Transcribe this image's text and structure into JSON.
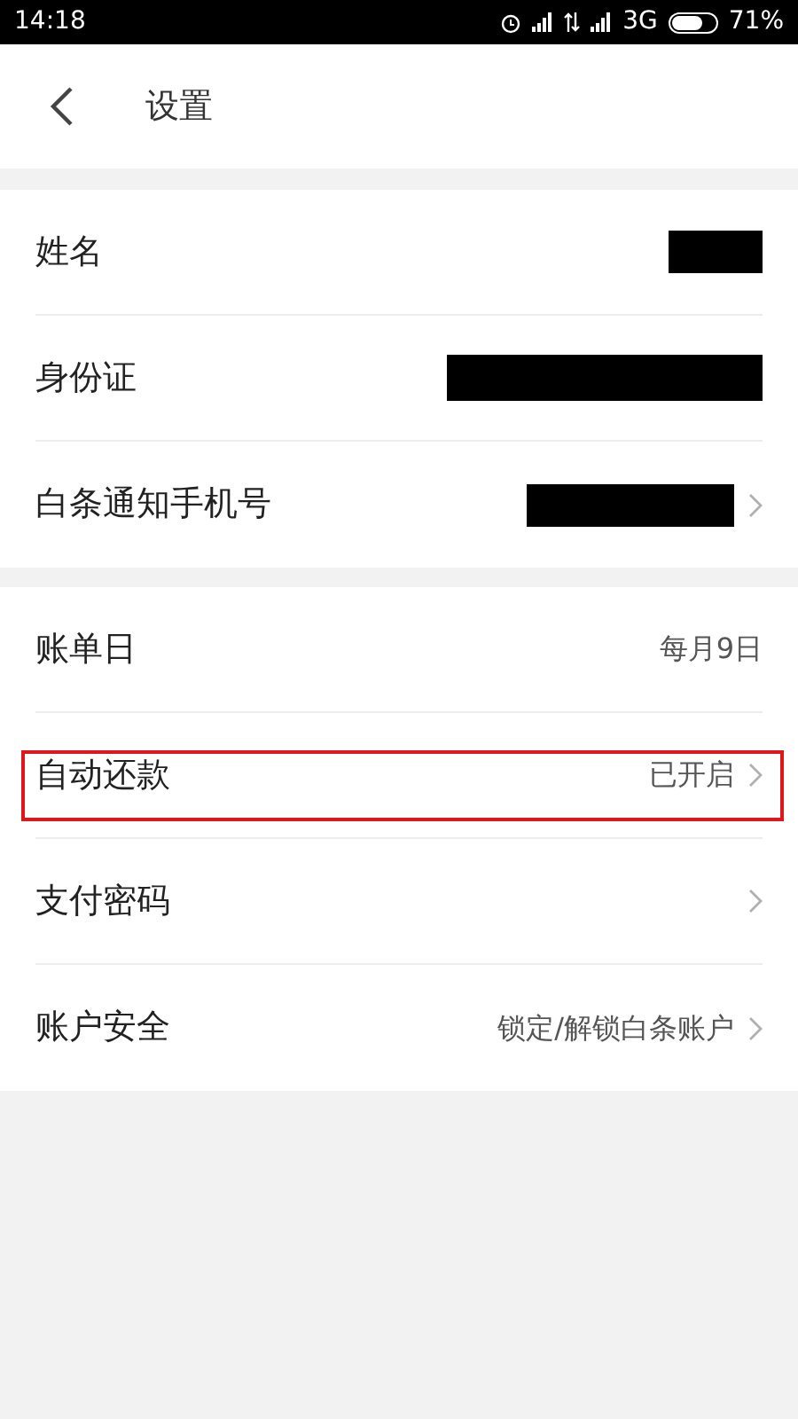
{
  "status_bar": {
    "time": "14:18",
    "network": "3G",
    "battery_text": "71%",
    "battery": {
      "level": 0.71
    }
  },
  "header": {
    "title": "设置"
  },
  "groups": [
    {
      "rows": [
        {
          "label": "姓名",
          "redacted": true,
          "arrow": false,
          "highlighted": false
        },
        {
          "label": "身份证",
          "redacted": true,
          "arrow": false,
          "highlighted": false
        },
        {
          "label": "白条通知手机号",
          "redacted": true,
          "arrow": true,
          "highlighted": false
        }
      ]
    },
    {
      "rows": [
        {
          "label": "账单日",
          "value": "每月9日",
          "redacted": false,
          "arrow": false,
          "highlighted": false
        },
        {
          "label": "自动还款",
          "value": "已开启",
          "redacted": false,
          "arrow": true,
          "highlighted": true
        },
        {
          "label": "支付密码",
          "redacted": false,
          "arrow": true,
          "highlighted": false
        },
        {
          "label": "账户安全",
          "value": "锁定/解锁白条账户",
          "redacted": false,
          "arrow": true,
          "highlighted": false
        }
      ]
    }
  ]
}
